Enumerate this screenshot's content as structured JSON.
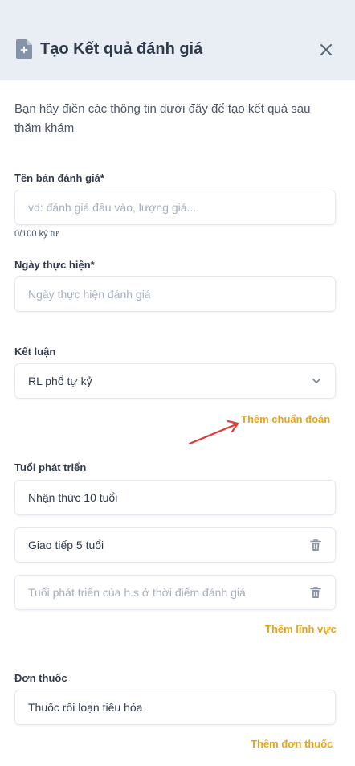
{
  "header": {
    "title": "Tạo Kết quả đánh giá",
    "icon": "document-add-icon",
    "close_icon": "close-icon"
  },
  "intro": "Bạn hãy điền các thông tin dưới đây để tạo kết quả sau thăm khám",
  "assessment_name": {
    "label": "Tên bản đánh giá*",
    "placeholder": "vd: đánh giá đầu vào, lượng giá....",
    "counter": "0/100 ký tự"
  },
  "date": {
    "label": "Ngày thực hiện*",
    "placeholder": "Ngày thực hiện đánh giá"
  },
  "conclusion": {
    "label": "Kết luận",
    "selected": "RL phổ tự kỷ",
    "add_link": "Thêm chuẩn đoán"
  },
  "development_age": {
    "label": "Tuổi phát triển",
    "items": [
      {
        "value": "Nhận thức 10 tuổi"
      },
      {
        "value": "Giao tiếp 5 tuổi"
      }
    ],
    "empty_placeholder": "Tuổi phát triển của h.s ở thời điểm đánh giá",
    "add_link": "Thêm lĩnh vực"
  },
  "prescription": {
    "label": "Đơn thuốc",
    "value": "Thuốc rối loạn tiêu hóa",
    "add_link": "Thêm đơn thuốc"
  },
  "colors": {
    "accent": "#e8a317",
    "annotation_arrow": "#e53935",
    "header_bg": "#e9eef4"
  }
}
